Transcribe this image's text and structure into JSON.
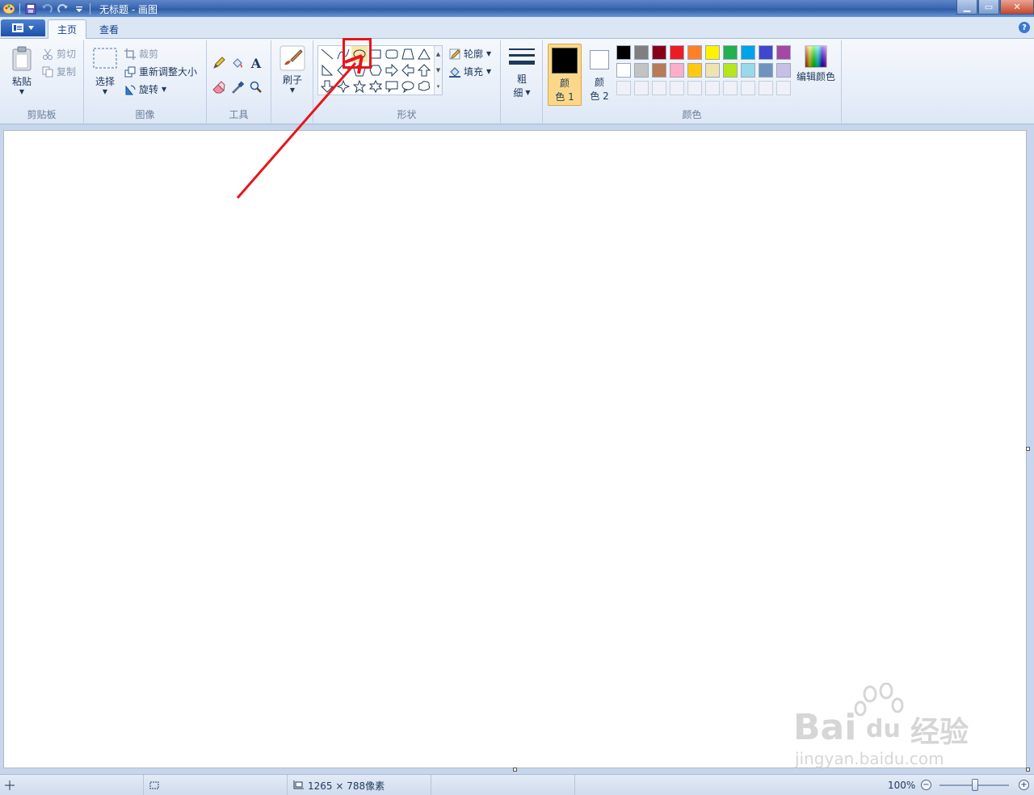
{
  "window": {
    "title": "无标题 - 画图",
    "min_symbol": "▁",
    "max_symbol": "▭",
    "close_symbol": "✕"
  },
  "tabs": {
    "home": "主页",
    "view": "查看"
  },
  "clipboard": {
    "paste": "粘贴",
    "cut": "剪切",
    "copy": "复制",
    "group": "剪贴板"
  },
  "image": {
    "select": "选择",
    "crop": "裁剪",
    "resize": "重新调整大小",
    "rotate": "旋转",
    "group": "图像"
  },
  "tools": {
    "group": "工具",
    "text_glyph": "A"
  },
  "brushes": {
    "label": "刷子"
  },
  "shapes": {
    "outline": "轮廓",
    "fill": "填充",
    "group": "形状"
  },
  "size": {
    "line1": "粗",
    "line2": "细"
  },
  "colors": {
    "color1_line1": "颜",
    "color1_line2": "色 1",
    "color2_line1": "颜",
    "color2_line2": "色 2",
    "edit": "编辑颜色",
    "group": "颜色",
    "color1_value": "#000000",
    "color2_value": "#ffffff",
    "palette_row1": [
      "#000000",
      "#7f7f7f",
      "#880015",
      "#ed1c24",
      "#ff7f27",
      "#fff200",
      "#22b14c",
      "#00a2e8",
      "#3f48cc",
      "#a349a4"
    ],
    "palette_row2": [
      "#ffffff",
      "#c3c3c3",
      "#b97a57",
      "#ffaec9",
      "#ffc90e",
      "#efe4b0",
      "#b5e61d",
      "#99d9ea",
      "#7092be",
      "#c8bfe7"
    ]
  },
  "status": {
    "canvas_size": "1265 × 788像素",
    "zoom": "100%"
  },
  "watermark": {
    "brand": "Bai",
    "brand2": "du",
    "product": "经验",
    "url": "jingyan.baidu.com"
  },
  "annotation": {
    "color": "#e8141b"
  }
}
